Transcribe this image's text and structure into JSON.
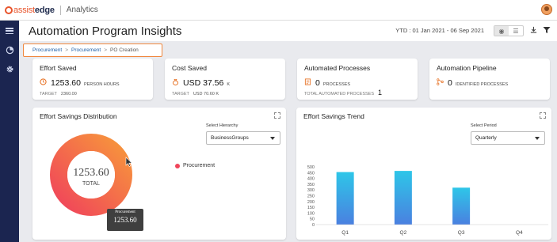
{
  "brand": {
    "name_part1": "assist",
    "name_part2": "edge",
    "app_name": "Analytics"
  },
  "header": {
    "title": "Automation Program Insights",
    "ytd_label": "YTD : 01 Jan 2021 - 06 Sep 2021"
  },
  "breadcrumb": {
    "items": [
      "Procurement",
      "Procurement",
      "PO Creation"
    ],
    "separator": ">"
  },
  "kpis": {
    "effort_saved": {
      "title": "Effort Saved",
      "value": "1253.60",
      "unit": "PERSON HOURS",
      "sub_label": "TARGET",
      "sub_value": "2360.00"
    },
    "cost_saved": {
      "title": "Cost Saved",
      "value": "USD 37.56",
      "unit": "K",
      "sub_label": "TARGET",
      "sub_value": "USD 70.60 K"
    },
    "automated_processes": {
      "title": "Automated Processes",
      "value": "0",
      "unit": "PROCESSES",
      "sub_label": "TOTAL AUTOMATED PROCESSES",
      "sub_value": "1"
    },
    "automation_pipeline": {
      "title": "Automation Pipeline",
      "value": "0",
      "unit": "IDENTIFIED PROCESSES"
    }
  },
  "distribution": {
    "title": "Effort Savings Distribution",
    "select_label": "Select Hierarchy",
    "select_value": "BusinessGroups",
    "center_value": "1253.60",
    "center_label": "TOTAL",
    "legend_label": "Procurement",
    "tooltip_label": "Procurement",
    "tooltip_value": "1253.60"
  },
  "trend": {
    "title": "Effort Savings Trend",
    "select_label": "Select Period",
    "select_value": "Quarterly"
  },
  "chart_data": {
    "type": "bar",
    "categories": [
      "Q1",
      "Q2",
      "Q3",
      "Q4"
    ],
    "values": [
      455,
      465,
      320,
      0
    ],
    "ylim": [
      0,
      500
    ],
    "yticks": [
      0,
      50,
      100,
      150,
      200,
      250,
      300,
      350,
      400,
      450,
      500
    ],
    "title": "",
    "xlabel": "",
    "ylabel": "",
    "grid": false
  },
  "colors": {
    "accent": "#f0883e",
    "nav_bg": "#1b2550",
    "donut_start": "#f0455a",
    "donut_end": "#f7953c",
    "bar_top": "#2ec6e8",
    "bar_bottom": "#4a80e0",
    "legend_dot": "#f0455a"
  }
}
